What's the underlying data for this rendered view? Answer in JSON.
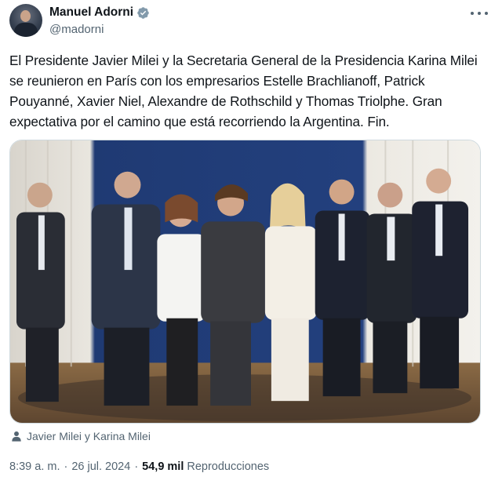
{
  "author": {
    "display_name": "Manuel Adorni",
    "handle": "@madorni",
    "verified": true
  },
  "tweet": {
    "text": "El Presidente Javier Milei y la Secretaria General de la Presidencia Karina Milei se reunieron en París con los empresarios Estelle Brachlianoff, Patrick Pouyanné, Xavier Niel, Alexandre de Rothschild y Thomas Triolphe. Gran expectativa por el camino que está recorriendo la Argentina. Fin.",
    "tagged": "Javier Milei y Karina Milei"
  },
  "meta": {
    "time": "8:39 a. m.",
    "separator": "·",
    "date": "26 jul. 2024",
    "views_count": "54,9 mil",
    "views_label": "Reproducciones"
  },
  "icons": {
    "verified": "verified-badge-icon",
    "more": "more-options-icon",
    "tagged": "person-icon"
  },
  "colors": {
    "text_primary": "#0f1419",
    "text_secondary": "#536471",
    "verified_badge": "#829aab"
  }
}
